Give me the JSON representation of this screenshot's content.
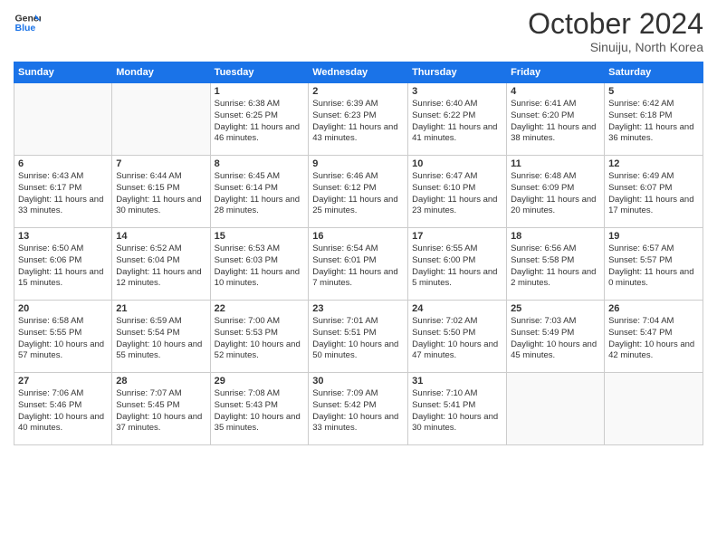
{
  "header": {
    "logo_line1": "General",
    "logo_line2": "Blue",
    "month": "October 2024",
    "location": "Sinuiju, North Korea"
  },
  "days_of_week": [
    "Sunday",
    "Monday",
    "Tuesday",
    "Wednesday",
    "Thursday",
    "Friday",
    "Saturday"
  ],
  "weeks": [
    [
      {
        "day": "",
        "sunrise": "",
        "sunset": "",
        "daylight": ""
      },
      {
        "day": "",
        "sunrise": "",
        "sunset": "",
        "daylight": ""
      },
      {
        "day": "1",
        "sunrise": "Sunrise: 6:38 AM",
        "sunset": "Sunset: 6:25 PM",
        "daylight": "Daylight: 11 hours and 46 minutes."
      },
      {
        "day": "2",
        "sunrise": "Sunrise: 6:39 AM",
        "sunset": "Sunset: 6:23 PM",
        "daylight": "Daylight: 11 hours and 43 minutes."
      },
      {
        "day": "3",
        "sunrise": "Sunrise: 6:40 AM",
        "sunset": "Sunset: 6:22 PM",
        "daylight": "Daylight: 11 hours and 41 minutes."
      },
      {
        "day": "4",
        "sunrise": "Sunrise: 6:41 AM",
        "sunset": "Sunset: 6:20 PM",
        "daylight": "Daylight: 11 hours and 38 minutes."
      },
      {
        "day": "5",
        "sunrise": "Sunrise: 6:42 AM",
        "sunset": "Sunset: 6:18 PM",
        "daylight": "Daylight: 11 hours and 36 minutes."
      }
    ],
    [
      {
        "day": "6",
        "sunrise": "Sunrise: 6:43 AM",
        "sunset": "Sunset: 6:17 PM",
        "daylight": "Daylight: 11 hours and 33 minutes."
      },
      {
        "day": "7",
        "sunrise": "Sunrise: 6:44 AM",
        "sunset": "Sunset: 6:15 PM",
        "daylight": "Daylight: 11 hours and 30 minutes."
      },
      {
        "day": "8",
        "sunrise": "Sunrise: 6:45 AM",
        "sunset": "Sunset: 6:14 PM",
        "daylight": "Daylight: 11 hours and 28 minutes."
      },
      {
        "day": "9",
        "sunrise": "Sunrise: 6:46 AM",
        "sunset": "Sunset: 6:12 PM",
        "daylight": "Daylight: 11 hours and 25 minutes."
      },
      {
        "day": "10",
        "sunrise": "Sunrise: 6:47 AM",
        "sunset": "Sunset: 6:10 PM",
        "daylight": "Daylight: 11 hours and 23 minutes."
      },
      {
        "day": "11",
        "sunrise": "Sunrise: 6:48 AM",
        "sunset": "Sunset: 6:09 PM",
        "daylight": "Daylight: 11 hours and 20 minutes."
      },
      {
        "day": "12",
        "sunrise": "Sunrise: 6:49 AM",
        "sunset": "Sunset: 6:07 PM",
        "daylight": "Daylight: 11 hours and 17 minutes."
      }
    ],
    [
      {
        "day": "13",
        "sunrise": "Sunrise: 6:50 AM",
        "sunset": "Sunset: 6:06 PM",
        "daylight": "Daylight: 11 hours and 15 minutes."
      },
      {
        "day": "14",
        "sunrise": "Sunrise: 6:52 AM",
        "sunset": "Sunset: 6:04 PM",
        "daylight": "Daylight: 11 hours and 12 minutes."
      },
      {
        "day": "15",
        "sunrise": "Sunrise: 6:53 AM",
        "sunset": "Sunset: 6:03 PM",
        "daylight": "Daylight: 11 hours and 10 minutes."
      },
      {
        "day": "16",
        "sunrise": "Sunrise: 6:54 AM",
        "sunset": "Sunset: 6:01 PM",
        "daylight": "Daylight: 11 hours and 7 minutes."
      },
      {
        "day": "17",
        "sunrise": "Sunrise: 6:55 AM",
        "sunset": "Sunset: 6:00 PM",
        "daylight": "Daylight: 11 hours and 5 minutes."
      },
      {
        "day": "18",
        "sunrise": "Sunrise: 6:56 AM",
        "sunset": "Sunset: 5:58 PM",
        "daylight": "Daylight: 11 hours and 2 minutes."
      },
      {
        "day": "19",
        "sunrise": "Sunrise: 6:57 AM",
        "sunset": "Sunset: 5:57 PM",
        "daylight": "Daylight: 11 hours and 0 minutes."
      }
    ],
    [
      {
        "day": "20",
        "sunrise": "Sunrise: 6:58 AM",
        "sunset": "Sunset: 5:55 PM",
        "daylight": "Daylight: 10 hours and 57 minutes."
      },
      {
        "day": "21",
        "sunrise": "Sunrise: 6:59 AM",
        "sunset": "Sunset: 5:54 PM",
        "daylight": "Daylight: 10 hours and 55 minutes."
      },
      {
        "day": "22",
        "sunrise": "Sunrise: 7:00 AM",
        "sunset": "Sunset: 5:53 PM",
        "daylight": "Daylight: 10 hours and 52 minutes."
      },
      {
        "day": "23",
        "sunrise": "Sunrise: 7:01 AM",
        "sunset": "Sunset: 5:51 PM",
        "daylight": "Daylight: 10 hours and 50 minutes."
      },
      {
        "day": "24",
        "sunrise": "Sunrise: 7:02 AM",
        "sunset": "Sunset: 5:50 PM",
        "daylight": "Daylight: 10 hours and 47 minutes."
      },
      {
        "day": "25",
        "sunrise": "Sunrise: 7:03 AM",
        "sunset": "Sunset: 5:49 PM",
        "daylight": "Daylight: 10 hours and 45 minutes."
      },
      {
        "day": "26",
        "sunrise": "Sunrise: 7:04 AM",
        "sunset": "Sunset: 5:47 PM",
        "daylight": "Daylight: 10 hours and 42 minutes."
      }
    ],
    [
      {
        "day": "27",
        "sunrise": "Sunrise: 7:06 AM",
        "sunset": "Sunset: 5:46 PM",
        "daylight": "Daylight: 10 hours and 40 minutes."
      },
      {
        "day": "28",
        "sunrise": "Sunrise: 7:07 AM",
        "sunset": "Sunset: 5:45 PM",
        "daylight": "Daylight: 10 hours and 37 minutes."
      },
      {
        "day": "29",
        "sunrise": "Sunrise: 7:08 AM",
        "sunset": "Sunset: 5:43 PM",
        "daylight": "Daylight: 10 hours and 35 minutes."
      },
      {
        "day": "30",
        "sunrise": "Sunrise: 7:09 AM",
        "sunset": "Sunset: 5:42 PM",
        "daylight": "Daylight: 10 hours and 33 minutes."
      },
      {
        "day": "31",
        "sunrise": "Sunrise: 7:10 AM",
        "sunset": "Sunset: 5:41 PM",
        "daylight": "Daylight: 10 hours and 30 minutes."
      },
      {
        "day": "",
        "sunrise": "",
        "sunset": "",
        "daylight": ""
      },
      {
        "day": "",
        "sunrise": "",
        "sunset": "",
        "daylight": ""
      }
    ]
  ]
}
